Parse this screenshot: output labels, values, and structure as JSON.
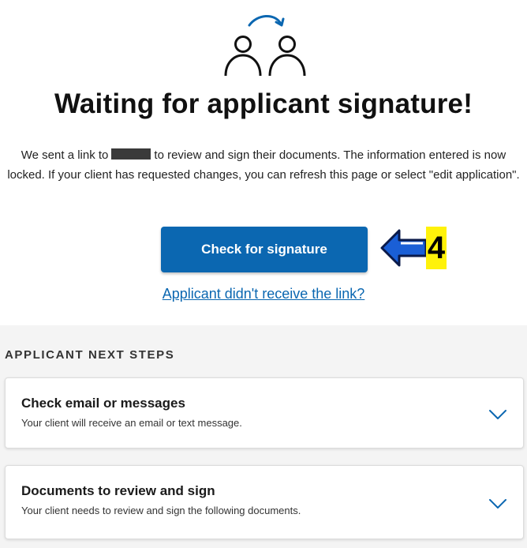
{
  "page": {
    "title": "Waiting for applicant signature!",
    "message_before": "We sent a link to",
    "message_after": "to review and sign their documents. The information entered is now locked. If your client has requested changes, you can refresh this page or select \"edit application\".",
    "primary_button": "Check for signature",
    "link": "Applicant didn't receive the link?"
  },
  "annotation": {
    "step_number": "4",
    "badge_color": "#fff20a",
    "arrow_color": "#1a5fd6"
  },
  "next_steps": {
    "heading": "APPLICANT NEXT STEPS",
    "items": [
      {
        "title": "Check email or messages",
        "description": "Your client will receive an email or text message."
      },
      {
        "title": "Documents to review and sign",
        "description": "Your client needs to review and sign the following documents."
      }
    ]
  },
  "icons": {
    "hero": "users-transfer-icon",
    "expand": "chevron-down-icon"
  },
  "colors": {
    "primary": "#0b67b1",
    "link": "#0b67b1"
  }
}
